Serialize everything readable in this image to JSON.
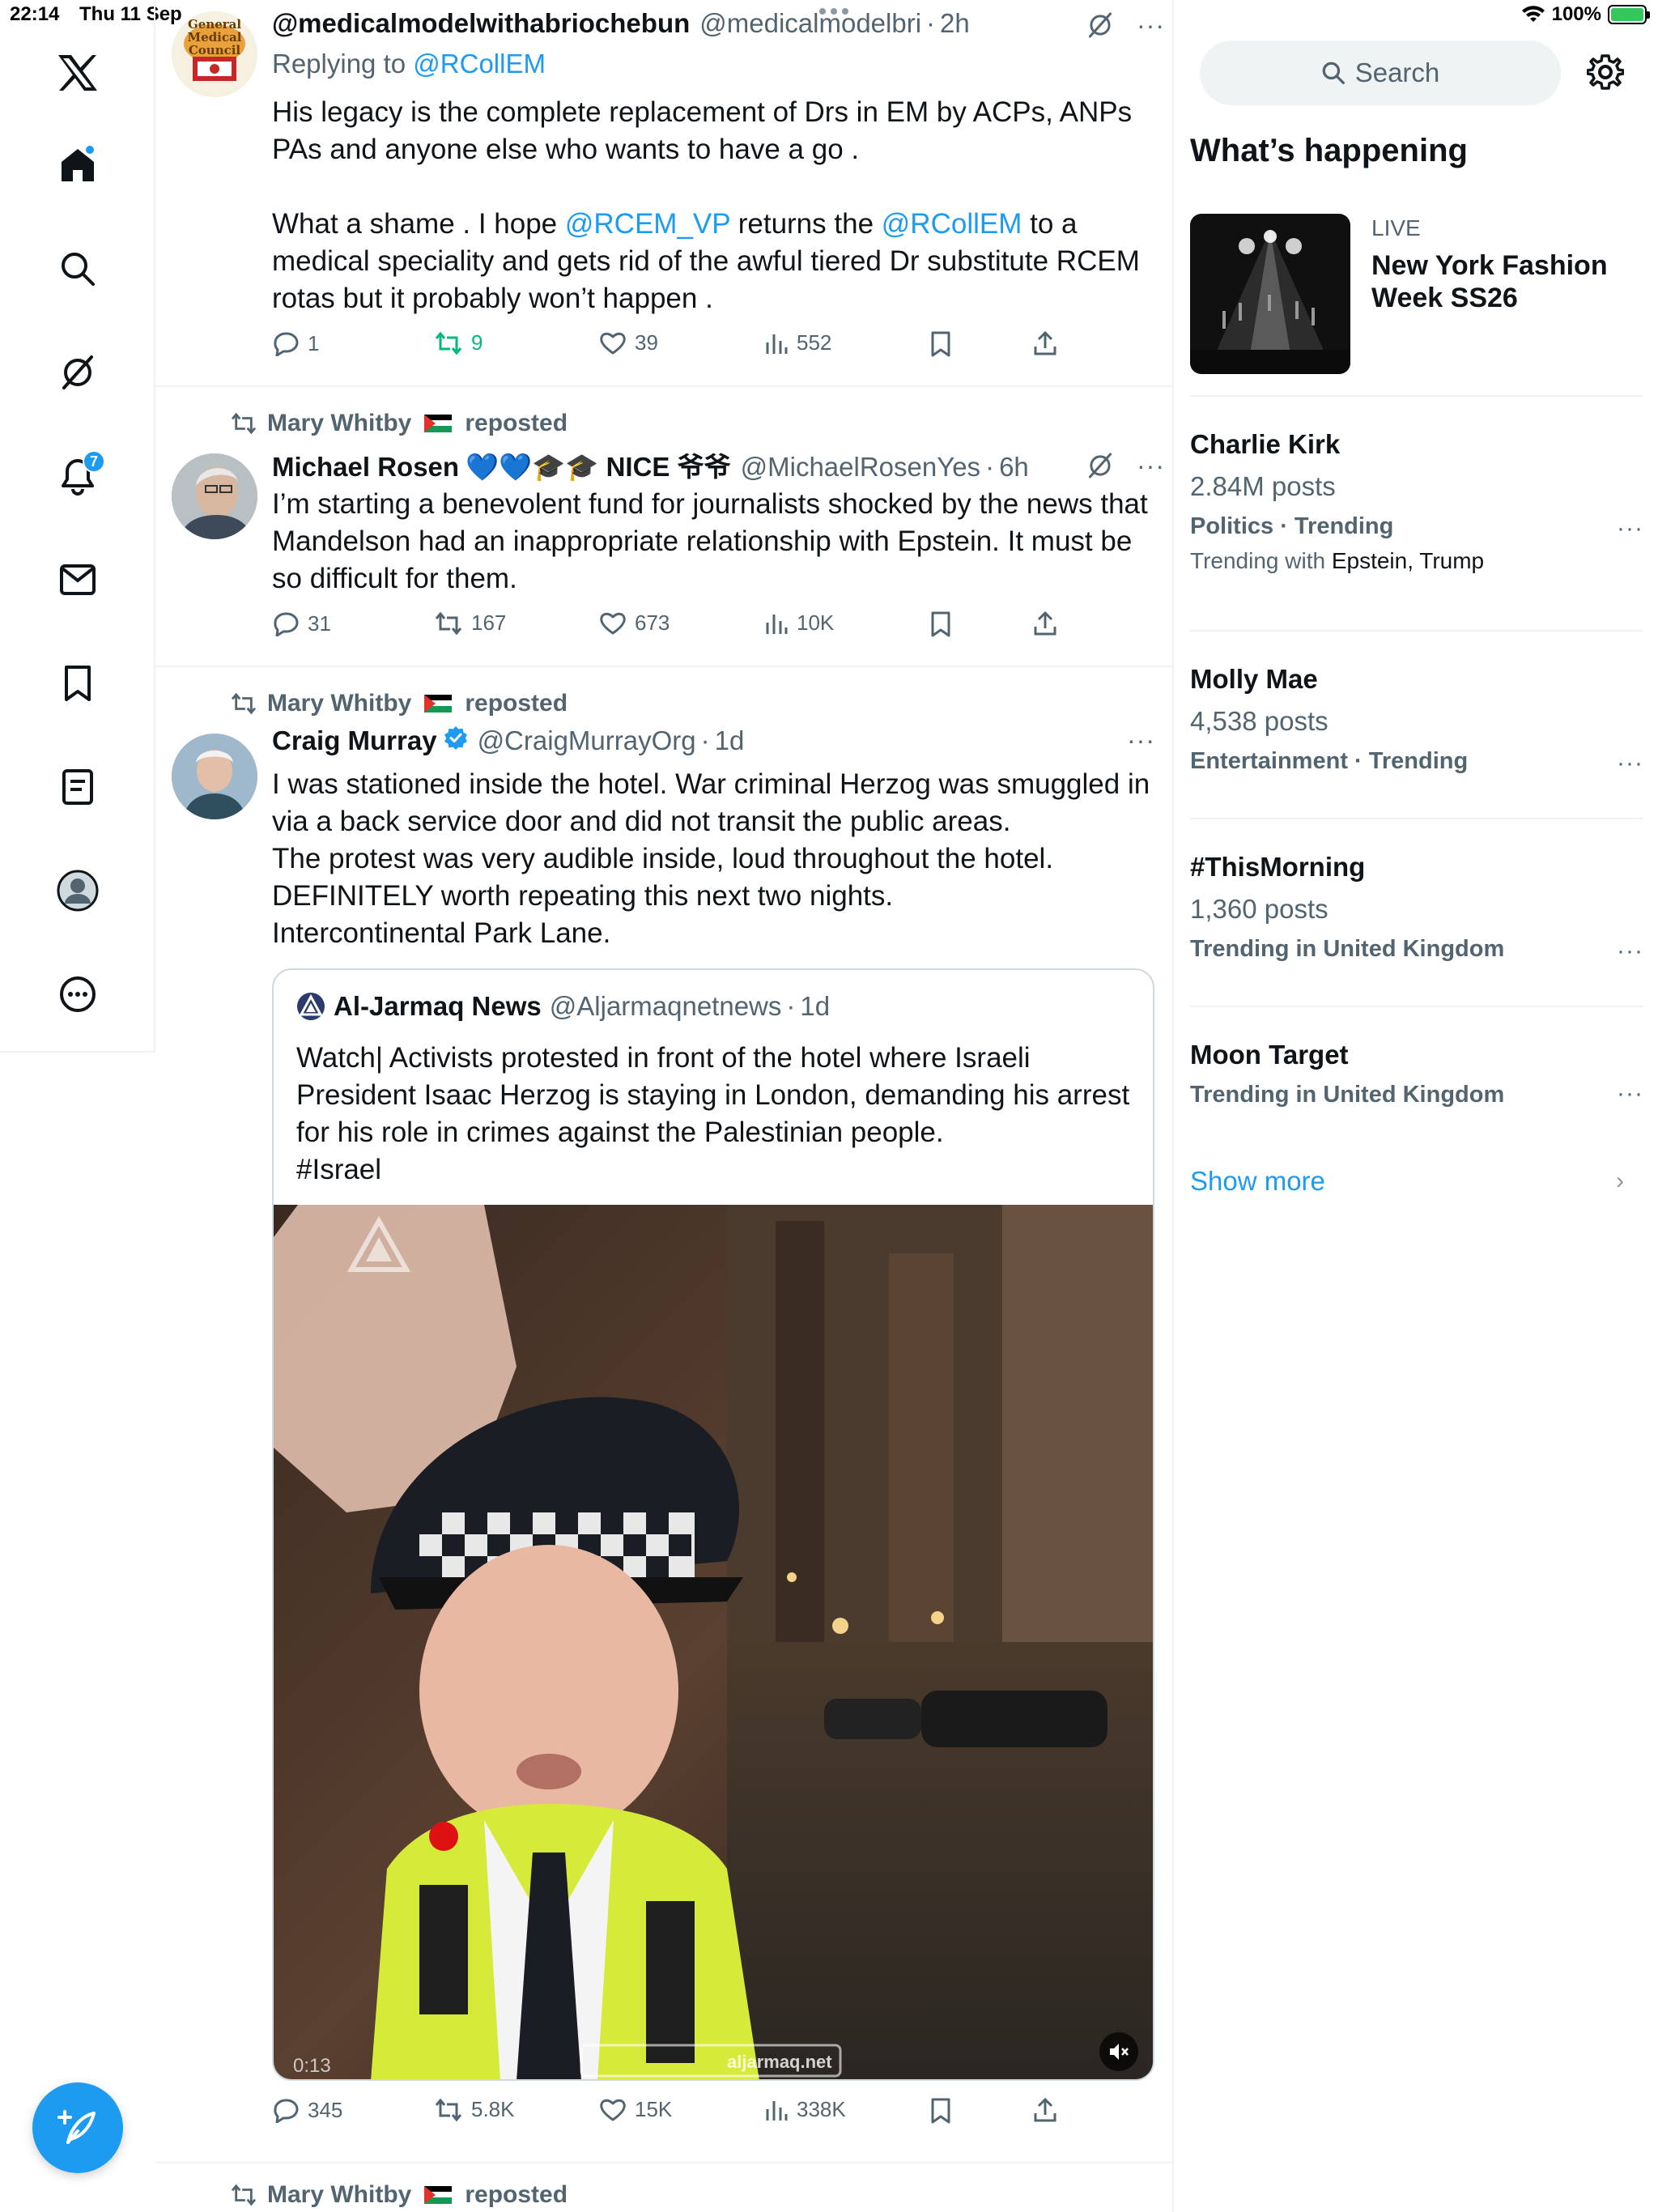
{
  "status_bar": {
    "time": "22:14",
    "date": "Thu 11 Sep",
    "battery": "100%",
    "battery_level": 1.0
  },
  "sidebar": {
    "notifications_badge": "7",
    "compose_label": "Post"
  },
  "tweets": [
    {
      "name": "@medicalmodelwithabriochebun",
      "handle": "@medicalmodelbri",
      "time": "2h",
      "reply_prefix": "Replying to",
      "reply_to": "@RCollEM",
      "text_p1": "His legacy is the complete replacement of Drs in EM by ACPs, ANPs PAs and anyone else who wants to have a go .",
      "text_p2_a": "What a shame . I hope",
      "text_p2_m1": "@RCEM_VP",
      "text_p2_b": "returns the",
      "text_p2_m2": "@RCollEM",
      "text_p2_c": "to a medical speciality and gets rid of the awful tiered Dr substitute RCEM rotas but it  probably won’t happen .",
      "avatar_text": "General Medical Council",
      "replies": "1",
      "reposts": "9",
      "likes": "39",
      "views": "552"
    },
    {
      "reposted_by": "Mary Whitby",
      "reposted_suffix": "reposted",
      "name": "Michael Rosen",
      "name_suffix": "💙💙🎓🎓 NICE 爷爷",
      "handle": "@MichaelRosenYes",
      "time": "6h",
      "text": "I’m starting a benevolent fund for journalists shocked by the news that Mandelson had an inappropriate relationship with Epstein. It must be so difficult for them.",
      "replies": "31",
      "reposts": "167",
      "likes": "673",
      "views": "10K"
    },
    {
      "reposted_by": "Mary Whitby",
      "reposted_suffix": "reposted",
      "name": "Craig Murray",
      "handle": "@CraigMurrayOrg",
      "time": "1d",
      "text_lines": [
        "I was stationed inside the hotel. War criminal Herzog was smuggled in via a back service door and did not transit the public areas.",
        "The protest was very audible inside, loud throughout the hotel.",
        "DEFINITELY worth repeating this next two nights.",
        "Intercontinental Park Lane."
      ],
      "quote": {
        "name": "Al-Jarmaq News",
        "handle": "@Aljarmaqnetnews",
        "time": "1d",
        "text_lines": [
          "Watch| Activists protested in front of the hotel where Israeli President Isaac Herzog is staying in London, demanding his arrest for his role in crimes against the Palestinian people.",
          "#Israel"
        ],
        "video_time": "0:13",
        "watermark": "aljarmaq.net"
      },
      "replies": "345",
      "reposts": "5.8K",
      "likes": "15K",
      "views": "338K"
    },
    {
      "reposted_by": "Mary Whitby",
      "reposted_suffix": "reposted"
    }
  ],
  "right": {
    "search_placeholder": "Search",
    "whats_happening": "What’s happening",
    "live_label": "LIVE",
    "live_title": "New York Fashion Week SS26",
    "trends": [
      {
        "name": "Charlie Kirk",
        "count": "2.84M posts",
        "category": "Politics · Trending",
        "with_prefix": "Trending with",
        "with_names": "Epstein, Trump"
      },
      {
        "name": "Molly Mae",
        "count": "4,538 posts",
        "category": "Entertainment · Trending"
      },
      {
        "name": "#ThisMorning",
        "count": "1,360 posts",
        "category": "Trending in United Kingdom"
      },
      {
        "name": "Moon Target",
        "category": "Trending in United Kingdom"
      }
    ],
    "show_more": "Show more"
  },
  "colors": {
    "accent": "#1d9bf0",
    "repost_green": "#00ba7c",
    "secondary_text": "#536471",
    "divider": "#eff3f4"
  },
  "icons": [
    "x-logo-icon",
    "home-icon",
    "search-icon",
    "grok-icon",
    "bell-icon",
    "mail-icon",
    "bookmark-icon",
    "lists-icon",
    "profile-icon",
    "more-icon",
    "compose-icon",
    "reply-icon",
    "repost-icon",
    "like-icon",
    "views-icon",
    "share-icon",
    "gear-icon",
    "verified-icon",
    "mute-icon"
  ]
}
